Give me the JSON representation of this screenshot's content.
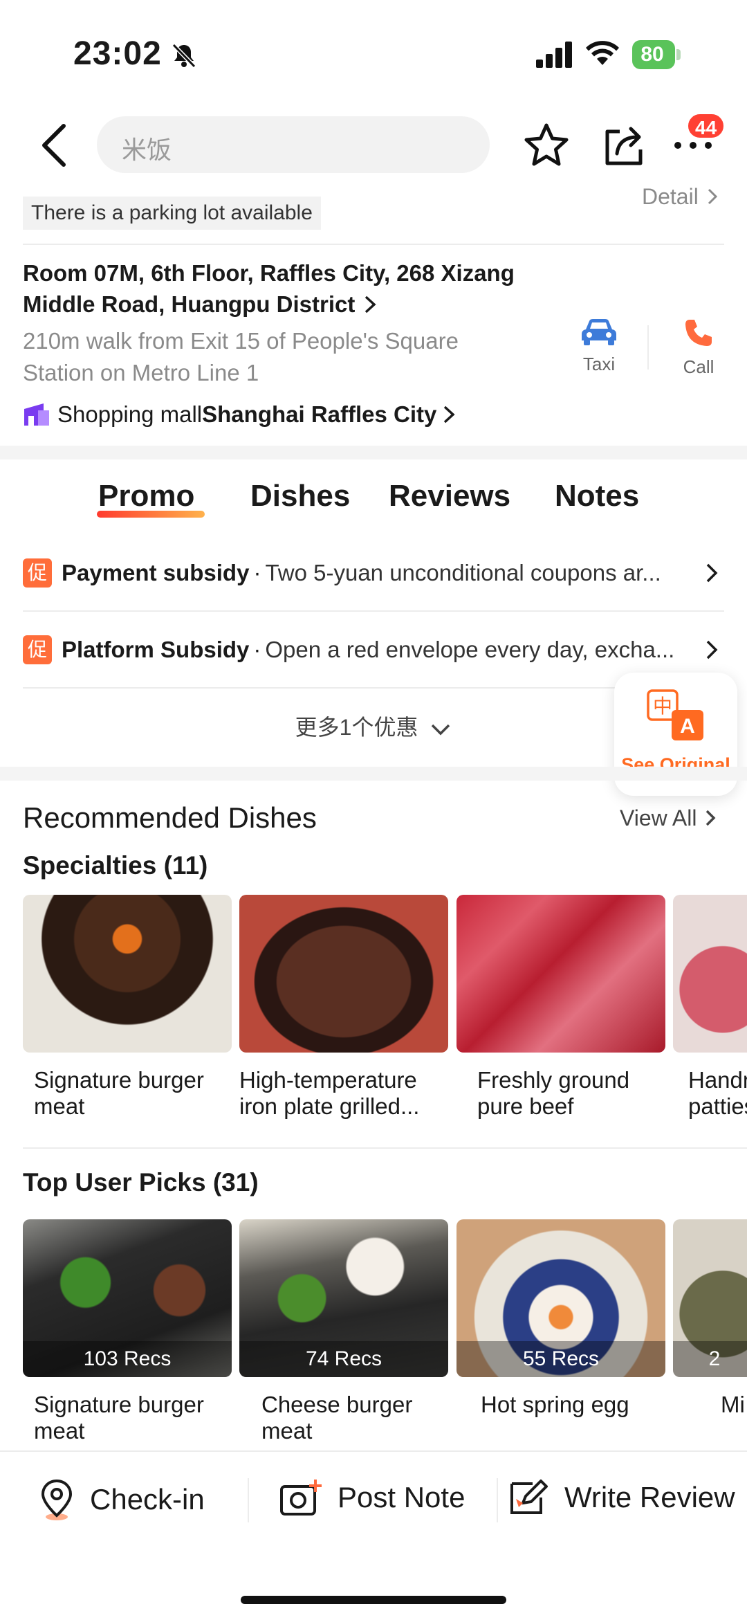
{
  "status_bar": {
    "time": "23:02",
    "battery": "80"
  },
  "nav": {
    "search_placeholder": "米饭",
    "badge_count": "44"
  },
  "info": {
    "parking_tag": "There is a parking lot available",
    "detail_link": "Detail",
    "address": "Room 07M, 6th Floor, Raffles City, 268 Xizang Middle Road, Huangpu District",
    "walk": "210m walk from Exit 15 of People's Square Station on Metro Line 1",
    "taxi_label": "Taxi",
    "call_label": "Call",
    "mall_prefix": "Shopping mall",
    "mall_name": "Shanghai Raffles City"
  },
  "tabs": [
    "Promo",
    "Dishes",
    "Reviews",
    "Notes"
  ],
  "promos": [
    {
      "icon": "促",
      "title": "Payment subsidy",
      "desc": "Two 5-yuan unconditional coupons ar..."
    },
    {
      "icon": "促",
      "title": "Platform Subsidy",
      "desc": "Open a red envelope every day, excha..."
    }
  ],
  "more_promos": "更多1个优惠",
  "translate": {
    "label": "See Original"
  },
  "recommended": {
    "title": "Recommended Dishes",
    "view_all": "View All",
    "specialties_title": "Specialties (11)",
    "specialties": [
      {
        "name": "Signature burger meat"
      },
      {
        "name": "High-temperature iron plate grilled..."
      },
      {
        "name": "Freshly ground pure beef"
      },
      {
        "name": "Handmade patties"
      }
    ],
    "top_picks_title": "Top User Picks (31)",
    "top_picks": [
      {
        "name": "Signature burger meat",
        "recs": "103 Recs"
      },
      {
        "name": "Cheese burger meat",
        "recs": "74 Recs"
      },
      {
        "name": "Hot spring egg",
        "recs": "55 Recs"
      },
      {
        "name": "Mi",
        "recs": "2"
      }
    ]
  },
  "bottom_bar": {
    "checkin": "Check-in",
    "post_note": "Post Note",
    "write_review": "Write Review"
  },
  "colors": {
    "accent": "#ff6a21",
    "promo_icon": "#ff6d3a",
    "taxi": "#3d7bd9",
    "call": "#ff6a3d",
    "badge": "#ff4033"
  }
}
